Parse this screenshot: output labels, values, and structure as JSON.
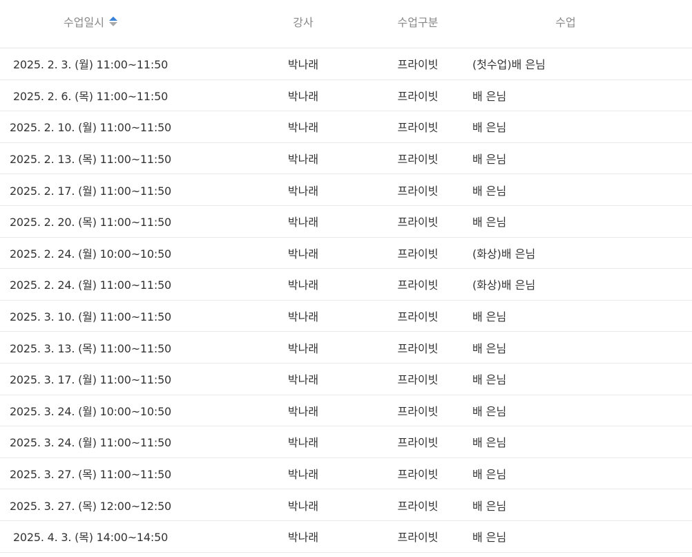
{
  "header": {
    "date": "수업일시",
    "teacher": "강사",
    "type": "수업구분",
    "class": "수업",
    "sort_icon": "sort-asc-icon",
    "accent_color": "#3a82d8"
  },
  "rows": [
    {
      "date": "2025. 2. 3. (월) 11:00~11:50",
      "teacher": "박나래",
      "type": "프라이빗",
      "class": "(첫수업)배   은님"
    },
    {
      "date": "2025. 2. 6. (목) 11:00~11:50",
      "teacher": "박나래",
      "type": "프라이빗",
      "class": "배   은님"
    },
    {
      "date": "2025. 2. 10. (월) 11:00~11:50",
      "teacher": "박나래",
      "type": "프라이빗",
      "class": "배   은님"
    },
    {
      "date": "2025. 2. 13. (목) 11:00~11:50",
      "teacher": "박나래",
      "type": "프라이빗",
      "class": "배   은님"
    },
    {
      "date": "2025. 2. 17. (월) 11:00~11:50",
      "teacher": "박나래",
      "type": "프라이빗",
      "class": "배   은님"
    },
    {
      "date": "2025. 2. 20. (목) 11:00~11:50",
      "teacher": "박나래",
      "type": "프라이빗",
      "class": "배   은님"
    },
    {
      "date": "2025. 2. 24. (월) 10:00~10:50",
      "teacher": "박나래",
      "type": "프라이빗",
      "class": "(화상)배   은님"
    },
    {
      "date": "2025. 2. 24. (월) 11:00~11:50",
      "teacher": "박나래",
      "type": "프라이빗",
      "class": "(화상)배   은님"
    },
    {
      "date": "2025. 3. 10. (월) 11:00~11:50",
      "teacher": "박나래",
      "type": "프라이빗",
      "class": "배   은님"
    },
    {
      "date": "2025. 3. 13. (목) 11:00~11:50",
      "teacher": "박나래",
      "type": "프라이빗",
      "class": "배   은님"
    },
    {
      "date": "2025. 3. 17. (월) 11:00~11:50",
      "teacher": "박나래",
      "type": "프라이빗",
      "class": "배   은님"
    },
    {
      "date": "2025. 3. 24. (월) 10:00~10:50",
      "teacher": "박나래",
      "type": "프라이빗",
      "class": "배   은님"
    },
    {
      "date": "2025. 3. 24. (월) 11:00~11:50",
      "teacher": "박나래",
      "type": "프라이빗",
      "class": "배   은님"
    },
    {
      "date": "2025. 3. 27. (목) 11:00~11:50",
      "teacher": "박나래",
      "type": "프라이빗",
      "class": "배   은님"
    },
    {
      "date": "2025. 3. 27. (목) 12:00~12:50",
      "teacher": "박나래",
      "type": "프라이빗",
      "class": "배   은님"
    },
    {
      "date": "2025. 4. 3. (목) 14:00~14:50",
      "teacher": "박나래",
      "type": "프라이빗",
      "class": "배   은님"
    }
  ]
}
